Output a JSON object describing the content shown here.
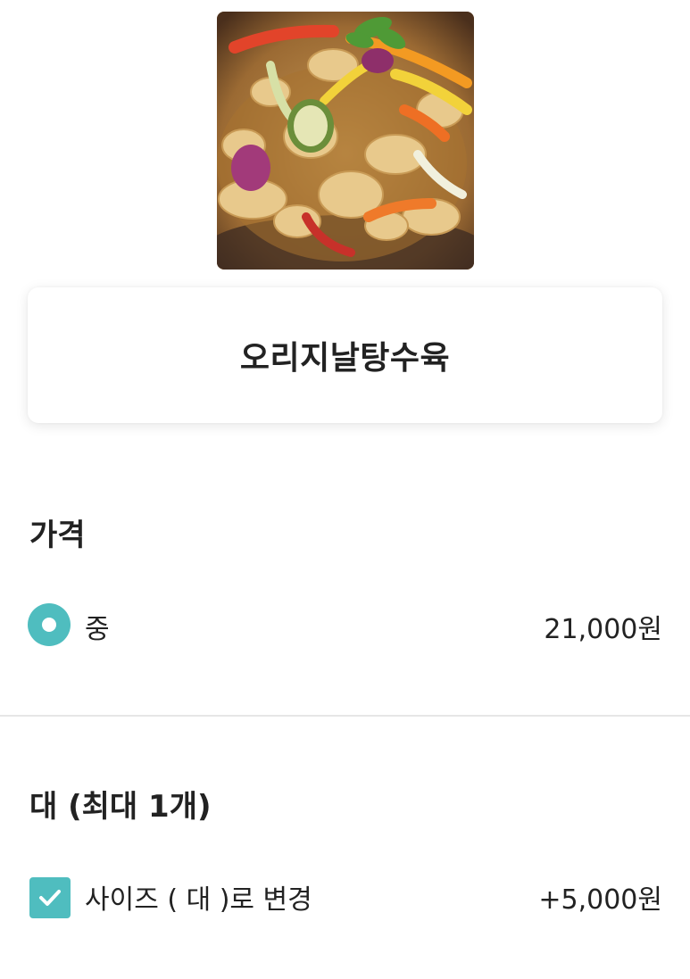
{
  "menu": {
    "name": "오리지날탕수육",
    "image_alt": "탕수육 음식 사진"
  },
  "price_section": {
    "title": "가격",
    "options": [
      {
        "label": "중",
        "price": "21,000원",
        "selected": true
      }
    ]
  },
  "large_section": {
    "title": "대 (최대 1개)",
    "options": [
      {
        "label": "사이즈 ( 대 )로 변경",
        "price": "+5,000원",
        "checked": true
      }
    ]
  },
  "colors": {
    "accent": "#4fbdbf",
    "text": "#222222",
    "divider": "#e6e6e6",
    "background": "#ffffff"
  },
  "icons": {
    "radio": "radio-selected-icon",
    "checkbox": "checkbox-checked-icon"
  }
}
